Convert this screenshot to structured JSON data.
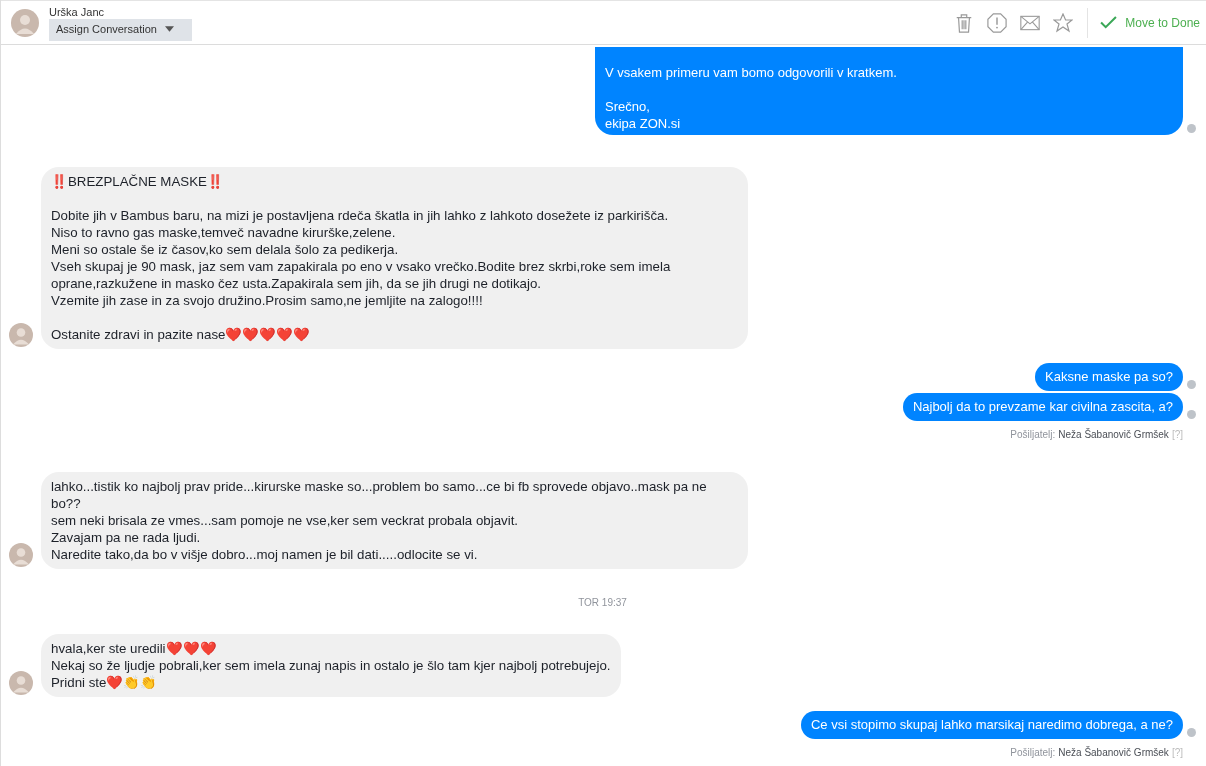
{
  "header": {
    "contact_name": "Urška Janc",
    "assign_button": "Assign Conversation",
    "done_button": "Move to Done"
  },
  "messages": [
    {
      "kind": "outgoing_continued",
      "paragraphs": [
        [
          "V vsakem primeru vam bomo odgovorili v kratkem."
        ],
        [
          "Srečno,",
          "ekipa ZON.si"
        ]
      ]
    },
    {
      "kind": "incoming",
      "paragraphs": [
        [
          "‼️BREZPLAČNE MASKE‼️"
        ],
        [
          "Dobite jih v Bambus baru, na mizi je postavljena rdeča škatla in jih lahko z lahkoto dosežete iz parkirišča.",
          "Niso to ravno gas maske,temveč navadne kirurške,zelene.",
          "Meni so ostale še iz časov,ko sem delala šolo za pedikerja.",
          "Vseh skupaj je 90 mask, jaz sem vam zapakirala po eno v vsako vrečko.Bodite brez skrbi,roke sem imela oprane,razkužene in masko čez usta.Zapakirala sem jih, da se jih drugi ne dotikajo.",
          "Vzemite jih zase in za svojo družino.Prosim samo,ne jemljite na zalogo!!!!"
        ],
        [
          "Ostanite zdravi in pazite nase❤️❤️❤️❤️❤️"
        ]
      ]
    },
    {
      "kind": "outgoing",
      "paragraphs": [
        [
          "Kaksne maske pa so?"
        ]
      ]
    },
    {
      "kind": "outgoing",
      "paragraphs": [
        [
          "Najbolj da to prevzame kar civilna zascita, a?"
        ]
      ]
    },
    {
      "kind": "sender",
      "label": "Pošiljatelj:",
      "name": "Neža Šabanovič Grmšek",
      "help": "[?]"
    },
    {
      "kind": "incoming",
      "paragraphs": [
        [
          "lahko...tistik ko najbolj prav pride...kirurske maske so...problem bo samo...ce bi fb sprovede objavo..mask pa ne bo??",
          "sem neki brisala ze vmes...sam pomoje ne vse,ker sem veckrat probala objavit.",
          "Zavajam pa ne rada ljudi.",
          "Naredite tako,da bo v višje dobro...moj namen je bil dati.....odlocite se vi."
        ]
      ]
    },
    {
      "kind": "timestamp",
      "text": "TOR 19:37"
    },
    {
      "kind": "incoming",
      "paragraphs": [
        [
          "hvala,ker ste uredili❤️❤️❤️",
          "Nekaj so že ljudje pobrali,ker sem imela zunaj napis in ostalo je šlo tam kjer najbolj potrebujejo.",
          "Pridni ste❤️👏👏"
        ]
      ]
    },
    {
      "kind": "outgoing",
      "paragraphs": [
        [
          "Ce vsi stopimo skupaj lahko marsikaj naredimo dobrega, a ne?"
        ]
      ]
    },
    {
      "kind": "sender",
      "label": "Pošiljatelj:",
      "name": "Neža Šabanovič Grmšek",
      "help": "[?]"
    }
  ]
}
